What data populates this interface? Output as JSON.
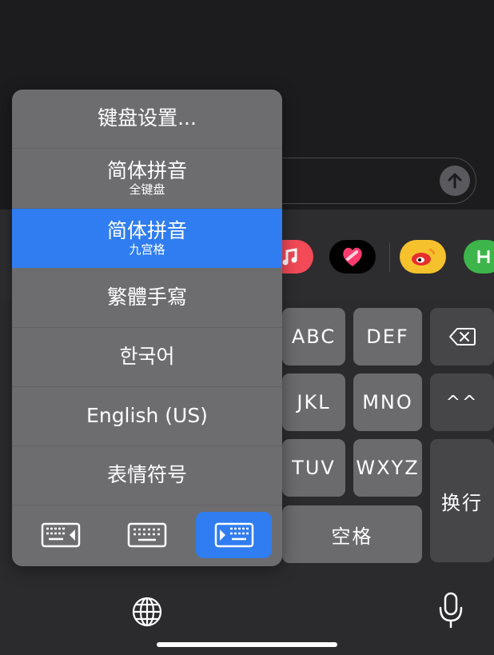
{
  "popup": {
    "items": [
      {
        "label": "键盘设置...",
        "sub": ""
      },
      {
        "label": "简体拼音",
        "sub": "全键盘"
      },
      {
        "label": "简体拼音",
        "sub": "九宫格"
      },
      {
        "label": "繁體手寫",
        "sub": ""
      },
      {
        "label": "한국어",
        "sub": ""
      },
      {
        "label": "English (US)",
        "sub": ""
      },
      {
        "label": "表情符号",
        "sub": ""
      }
    ],
    "selected_index": 2,
    "keyboard_modes": [
      "keyboard-left-icon",
      "keyboard-full-icon",
      "keyboard-right-icon"
    ],
    "active_mode": "keyboard-right-icon"
  },
  "keyboard": {
    "abc": "ABC",
    "def": "DEF",
    "jkl": "JKL",
    "mno": "MNO",
    "emoticon": "^^",
    "tuv": "TUV",
    "wxyz": "WXYZ",
    "return": "换行",
    "space": "空格"
  },
  "colors": {
    "accent": "#2f7df0",
    "popup_bg": "#6d6d70",
    "key_bg": "#6b6b6e",
    "func_key_bg": "#464649"
  }
}
